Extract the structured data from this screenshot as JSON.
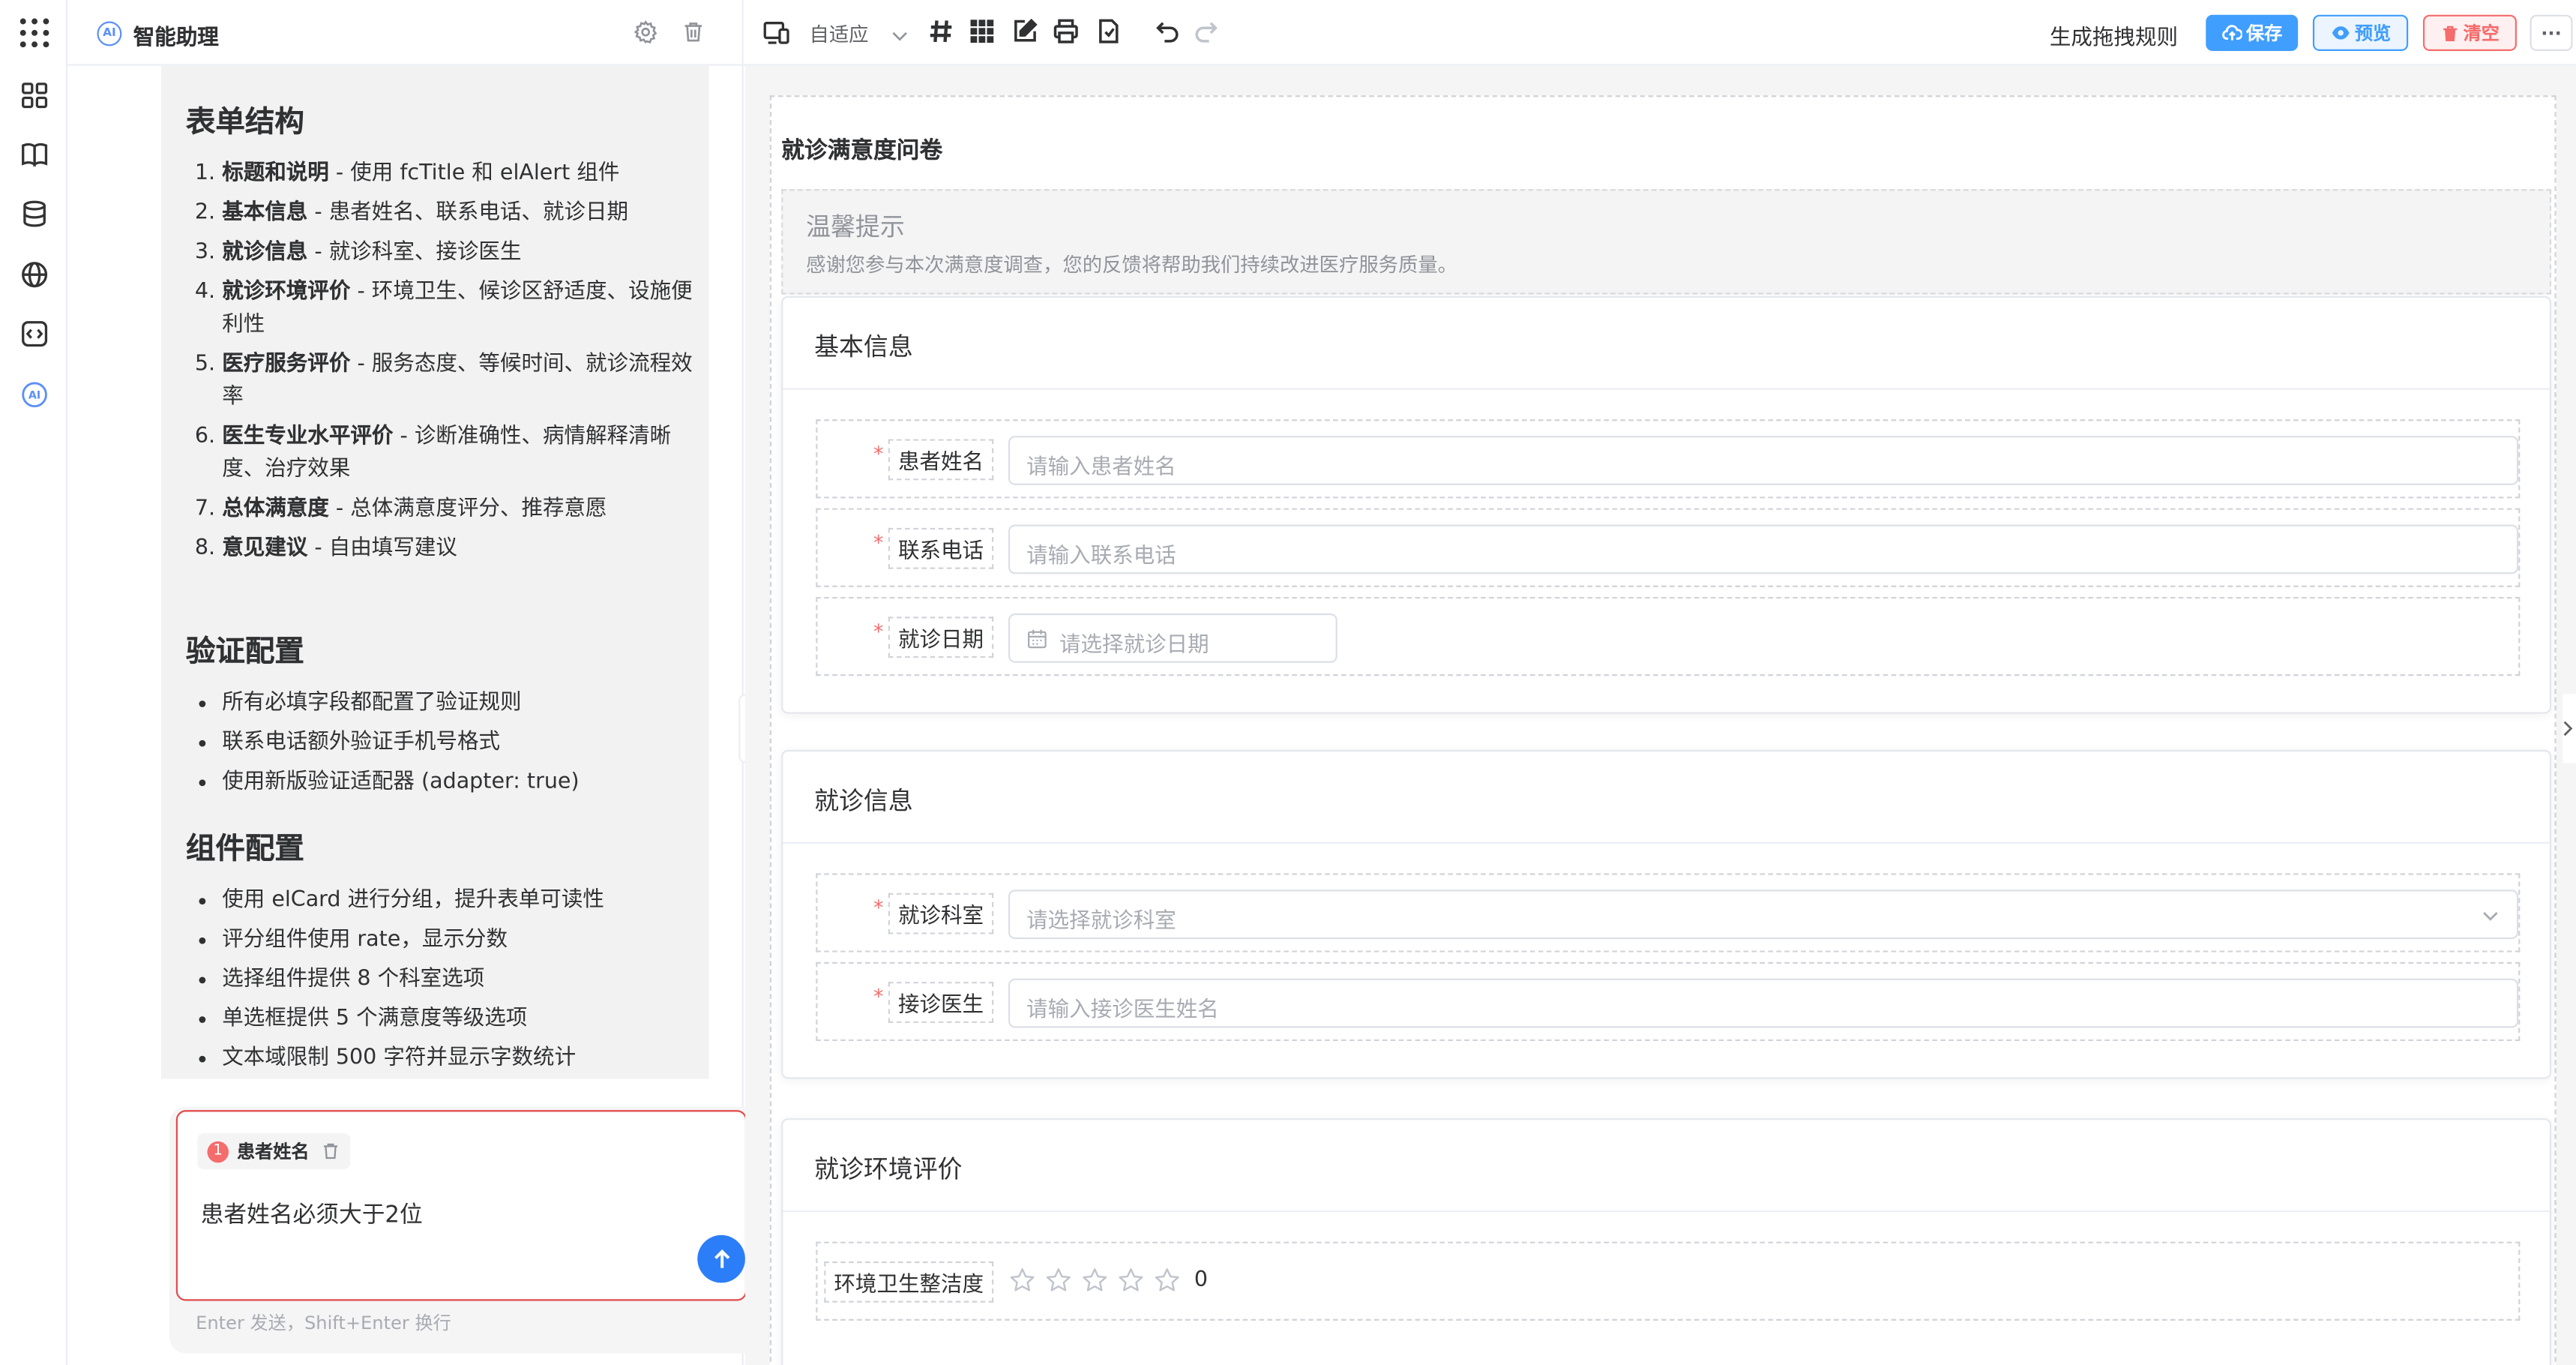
{
  "assistant": {
    "logo_text": "AI",
    "title": "智能助理",
    "sections": [
      {
        "heading": "表单结构",
        "ordered": true,
        "items": [
          {
            "bold": "标题和说明",
            "text": " - 使用 fcTitle 和 elAlert 组件"
          },
          {
            "bold": "基本信息",
            "text": " - 患者姓名、联系电话、就诊日期"
          },
          {
            "bold": "就诊信息",
            "text": " - 就诊科室、接诊医生"
          },
          {
            "bold": "就诊环境评价",
            "text": " - 环境卫生、候诊区舒适度、设施便利性"
          },
          {
            "bold": "医疗服务评价",
            "text": " - 服务态度、等候时间、就诊流程效率"
          },
          {
            "bold": "医生专业水平评价",
            "text": " - 诊断准确性、病情解释清晰度、治疗效果"
          },
          {
            "bold": "总体满意度",
            "text": " - 总体满意度评分、推荐意愿"
          },
          {
            "bold": "意见建议",
            "text": " - 自由填写建议"
          }
        ]
      },
      {
        "heading": "验证配置",
        "ordered": false,
        "items": [
          {
            "bold": "",
            "text": "所有必填字段都配置了验证规则"
          },
          {
            "bold": "",
            "text": "联系电话额外验证手机号格式"
          },
          {
            "bold": "",
            "text": "使用新版验证适配器 (adapter: true)"
          }
        ]
      },
      {
        "heading": "组件配置",
        "ordered": false,
        "items": [
          {
            "bold": "",
            "text": "使用 elCard 进行分组，提升表单可读性"
          },
          {
            "bold": "",
            "text": "评分组件使用 rate，显示分数"
          },
          {
            "bold": "",
            "text": "选择组件提供 8 个科室选项"
          },
          {
            "bold": "",
            "text": "单选框提供 5 个满意度等级选项"
          },
          {
            "bold": "",
            "text": "文本域限制 500 字符并显示字数统计"
          }
        ]
      }
    ],
    "composer": {
      "chip_number": "1",
      "chip_label": "患者姓名",
      "text": "患者姓名必须大于2位",
      "hint": "Enter 发送，Shift+Enter 换行"
    }
  },
  "toolbar": {
    "adapt_label": "自适应",
    "rule_label": "生成拖拽规则",
    "save_label": "保存",
    "preview_label": "预览",
    "clear_label": "清空",
    "more_label": "···"
  },
  "form": {
    "title": "就诊满意度问卷",
    "tip": {
      "title": "温馨提示",
      "desc": "感谢您参与本次满意度调查，您的反馈将帮助我们持续改进医疗服务质量。"
    },
    "cards": [
      {
        "title": "基本信息",
        "fields": [
          {
            "label": "患者姓名",
            "placeholder": "请输入患者姓名",
            "kind": "input",
            "required": true
          },
          {
            "label": "联系电话",
            "placeholder": "请输入联系电话",
            "kind": "input",
            "required": true
          },
          {
            "label": "就诊日期",
            "placeholder": "请选择就诊日期",
            "kind": "date",
            "required": true
          }
        ]
      },
      {
        "title": "就诊信息",
        "fields": [
          {
            "label": "就诊科室",
            "placeholder": "请选择就诊科室",
            "kind": "select",
            "required": true
          },
          {
            "label": "接诊医生",
            "placeholder": "请输入接诊医生姓名",
            "kind": "input",
            "required": true
          }
        ]
      },
      {
        "title": "就诊环境评价",
        "fields": [
          {
            "label": "环境卫生整洁度",
            "kind": "rate",
            "required": false,
            "value": "0",
            "max": 5
          }
        ]
      }
    ]
  },
  "colors": {
    "primary": "#409eff",
    "danger": "#f56c6c",
    "send": "#2c7ef8"
  }
}
